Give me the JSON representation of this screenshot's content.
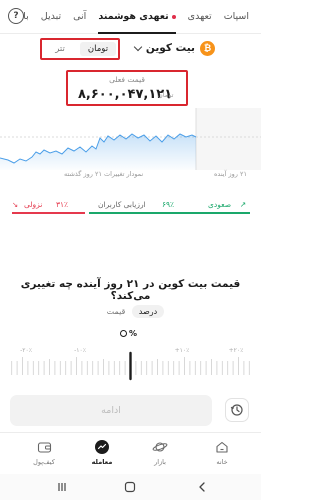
{
  "header": {
    "tabs": [
      {
        "label": "اسپات",
        "active": false
      },
      {
        "label": "تعهدی",
        "active": false
      },
      {
        "label": "تعهدی هوشمند",
        "active": true
      },
      {
        "label": "آنی",
        "active": false
      },
      {
        "label": "تبدیل",
        "active": false
      },
      {
        "label": "با",
        "active": false
      }
    ],
    "help_glyph": "?"
  },
  "asset": {
    "name": "بیت کوین",
    "logo_glyph": "₿",
    "currency_options": [
      "تومان",
      "تتر"
    ],
    "selected_currency": "تومان"
  },
  "price": {
    "label": "قیمت فعلی",
    "value": "۸,۶۰۰,۰۴۷,۱۲۱",
    "unit": "تومان"
  },
  "chart": {
    "caption_past": "نمودار تغییرات ۲۱ روز گذشته",
    "caption_future": "۲۱ روز آینده"
  },
  "sentiment": {
    "bullish_label": "صعودی",
    "bullish_pct": "۶۹٪",
    "bearish_label": "نزولی",
    "bearish_pct": "۳۱٪",
    "center_label": "ارزیابی کاربران",
    "bullish_fraction": 0.69,
    "bearish_fraction": 0.31,
    "colors": {
      "bullish": "#1aa86b",
      "bearish": "#e5394d"
    }
  },
  "question": {
    "text": "قیمت بیت کوین در ۲۱ روز آینده چه تغییری می‌کند؟"
  },
  "mode": {
    "options": [
      "درصد",
      "قیمت"
    ],
    "selected": "درصد"
  },
  "selector": {
    "value": "۰",
    "symbol": "%",
    "tick_labels": [
      "-۲۰٪",
      "-۱۰٪",
      "+۱۰٪",
      "+۲۰٪"
    ]
  },
  "actions": {
    "continue_label": "ادامه",
    "history_icon": "clock-history-icon"
  },
  "bottom_nav": [
    {
      "label": "خانه",
      "icon": "home-icon",
      "active": false
    },
    {
      "label": "بازار",
      "icon": "planet-icon",
      "active": false
    },
    {
      "label": "معامله",
      "icon": "trade-icon",
      "active": true
    },
    {
      "label": "کیف‌پول",
      "icon": "wallet-icon",
      "active": false
    }
  ]
}
